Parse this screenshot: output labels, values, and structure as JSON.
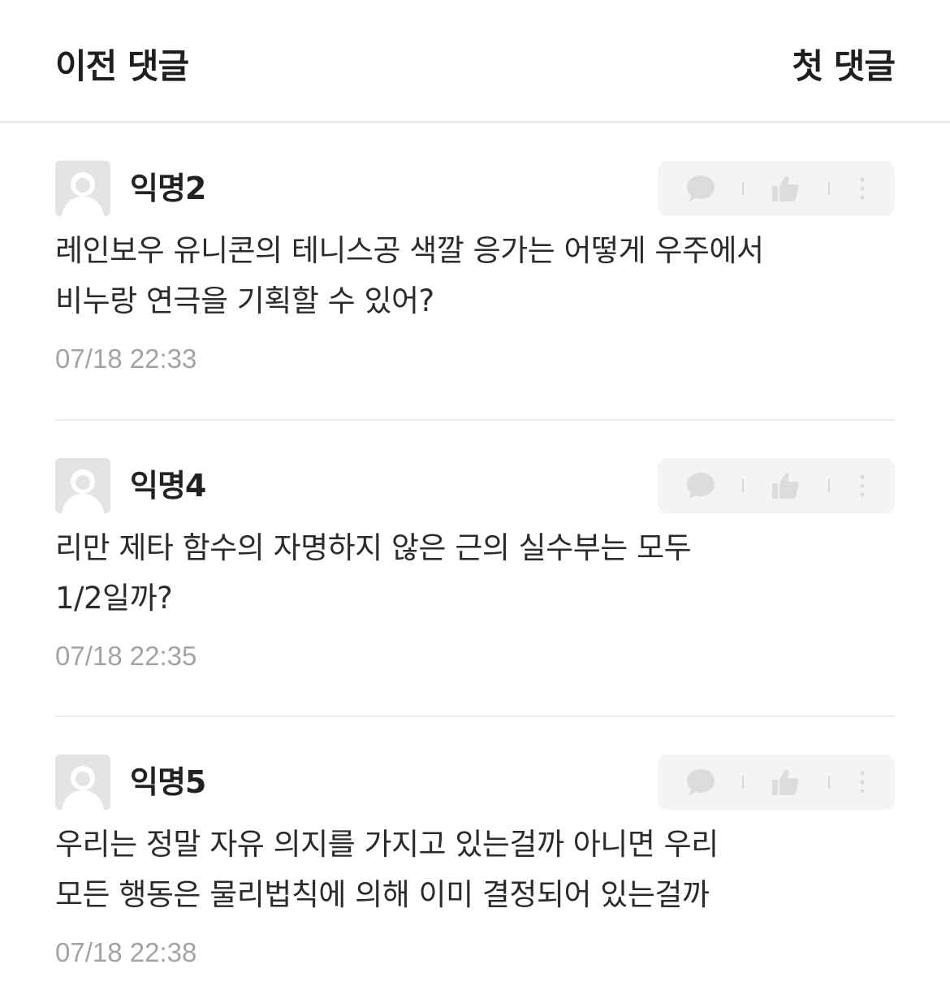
{
  "header": {
    "prev_label": "이전 댓글",
    "first_label": "첫 댓글"
  },
  "comments": [
    {
      "author": "익명2",
      "text_lines": [
        "레인보우 유니콘의 테니스공 색깔 응가는 어떻게 우주에서",
        "비누랑 연극을 기획할 수 있어?"
      ],
      "time": "07/18 22:33"
    },
    {
      "author": "익명4",
      "text_lines": [
        "리만 제타 함수의 자명하지 않은 근의 실수부는 모두",
        "1/2일까?"
      ],
      "time": "07/18 22:35"
    },
    {
      "author": "익명5",
      "text_lines": [
        "우리는 정말 자유 의지를 가지고 있는걸까 아니면 우리",
        "모든 행동은 물리법칙에 의해 이미 결정되어 있는걸까"
      ],
      "time": "07/18 22:38"
    }
  ],
  "icons": {
    "avatar": "default-user-icon",
    "reply": "speech-bubble-icon",
    "like": "thumbs-up-icon",
    "more": "vertical-dots-icon"
  },
  "colors": {
    "text": "#222222",
    "timestamp": "#a3a3a3",
    "action_bg": "#f4f4f4",
    "action_icon": "#dcdcdc",
    "divider": "#ececec"
  }
}
